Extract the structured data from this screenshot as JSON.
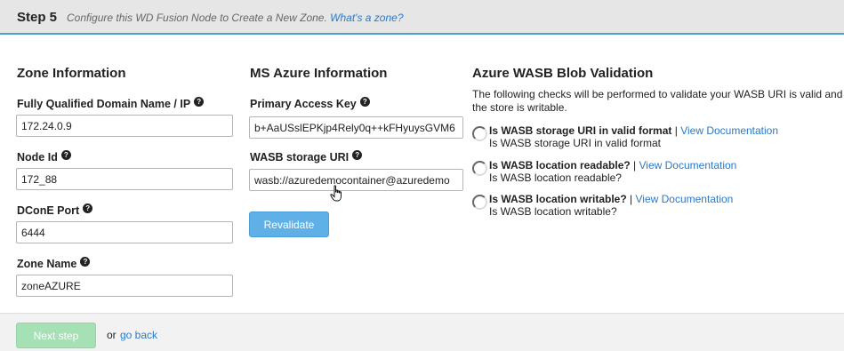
{
  "header": {
    "step": "Step 5",
    "description": "Configure this WD Fusion Node to Create a New Zone.",
    "help_link": "What's a zone?"
  },
  "zone_info": {
    "title": "Zone Information",
    "fqdn": {
      "label": "Fully Qualified Domain Name / IP",
      "value": "172.24.0.9"
    },
    "node_id": {
      "label": "Node Id",
      "value": "172_88"
    },
    "dcone_port": {
      "label": "DConE Port",
      "value": "6444"
    },
    "zone_name": {
      "label": "Zone Name",
      "value": "zoneAZURE"
    }
  },
  "azure_info": {
    "title": "MS Azure Information",
    "access_key": {
      "label": "Primary Access Key",
      "value": "b+AaUSslEPKjp4Rely0q++kFHyuysGVM6"
    },
    "wasb_uri": {
      "label": "WASB storage URI",
      "value": "wasb://azuredemocontainer@azuredemo"
    },
    "revalidate_label": "Revalidate"
  },
  "validation": {
    "title": "Azure WASB Blob Validation",
    "intro": "The following checks will be performed to validate your WASB URI is valid and the store is writable.",
    "checks": [
      {
        "title": "Is WASB storage URI in valid format",
        "separator": "|",
        "link": "View Documentation",
        "status": "Is WASB storage URI in valid format"
      },
      {
        "title": "Is WASB location readable?",
        "separator": "|",
        "link": "View Documentation",
        "status": "Is WASB location readable?"
      },
      {
        "title": "Is WASB location writable?",
        "separator": "|",
        "link": "View Documentation",
        "status": "Is WASB location writable?"
      }
    ]
  },
  "footer": {
    "next_label": "Next step",
    "or_text": "or",
    "back_label": "go back"
  },
  "colors": {
    "accent": "#4a9fd8",
    "link": "#2a7ac8",
    "next_button_disabled": "#a6e0b5",
    "header_bg": "#e6e6e6"
  },
  "icons": {
    "help": "question-circle-icon",
    "spinner": "spinner-icon",
    "cursor": "hand-pointer-cursor"
  }
}
